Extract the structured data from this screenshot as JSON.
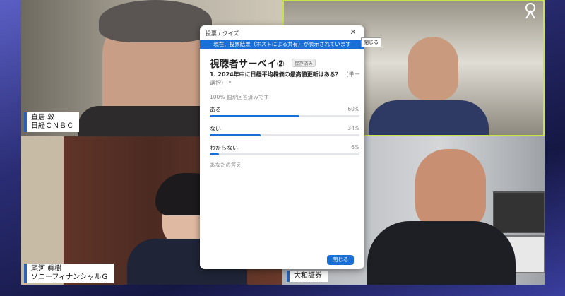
{
  "poll": {
    "header": "投票 / クイズ",
    "close_icon": "✕",
    "close_tooltip": "閉じる",
    "banner": "現在、投票結果（ホストによる共有）が表示されています",
    "title": "視聴者サーベイ②",
    "saved_badge": "保存済み",
    "question": "1. 2024年中に日経平均株価の最高値更新はある？",
    "question_suffix": "（単一選択） *",
    "answered": "100% 個が回答済みです",
    "options": [
      {
        "label": "ある",
        "percent_text": "60%",
        "value": 60
      },
      {
        "label": "ない",
        "percent_text": "34%",
        "value": 34
      },
      {
        "label": "わからない",
        "percent_text": "6%",
        "value": 6
      }
    ],
    "your_answer": "あなたの答え",
    "close_button": "閉じる"
  },
  "participants": [
    {
      "name": "直居 敦",
      "org": "日経ＣＮＢＣ"
    },
    {
      "name": "尾河 眞樹",
      "org": "ソニーフィナンシャルＧ"
    },
    {
      "name": "",
      "org": "大和証券"
    }
  ],
  "colors": {
    "accent": "#1a6fd6",
    "active_speaker": "#c8e24a",
    "nameplate_bar": "#2a62b8"
  }
}
